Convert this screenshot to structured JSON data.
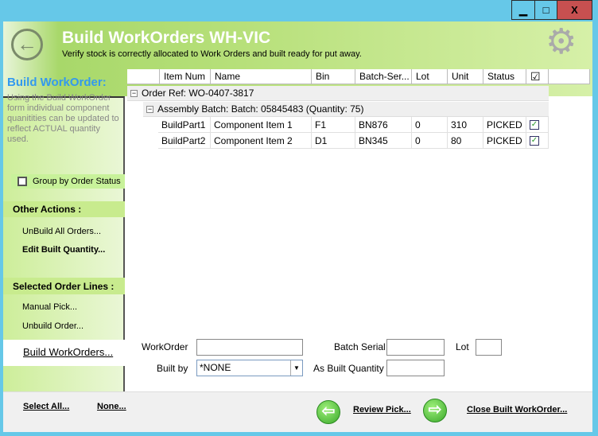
{
  "window": {
    "minimize": "▁",
    "maximize": "□",
    "close": "X"
  },
  "header": {
    "title": "Build WorkOrders WH-VIC",
    "subtitle": "Verify stock is correctly allocated to Work Orders and built ready for put away."
  },
  "sidebar": {
    "title": "Build WorkOrder:",
    "description": "Using the Build WorkOrder form individual component quanitities can be updated to reflect ACTUAL quantity used.",
    "group_by": "Group by Order Status",
    "group_by_checked": false,
    "other_actions": "Other Actions :",
    "unbuild_all": "UnBuild All Orders...",
    "edit_built": "Edit Built Quantity...",
    "selected_lines": "Selected Order Lines :",
    "manual_pick": "Manual Pick...",
    "unbuild_order": "Unbuild Order...",
    "build_workorders": "Build WorkOrders..."
  },
  "grid": {
    "columns": [
      "Item Num",
      "Name",
      "Bin",
      "Batch-Ser...",
      "Lot",
      "Unit",
      "Status",
      "☑"
    ],
    "order_ref": "Order Ref: WO-0407-3817",
    "assembly": "Assembly Batch: Batch: 05845483 (Quantity: 75)",
    "rows": [
      [
        "BuildPart1",
        "Component Item 1",
        "F1",
        "BN876",
        "0",
        "310",
        "PICKED",
        "✓"
      ],
      [
        "BuildPart2",
        "Component Item 2",
        "D1",
        "BN345",
        "0",
        "80",
        "PICKED",
        "✓"
      ]
    ]
  },
  "form": {
    "workorder_label": "WorkOrder",
    "workorder_value": "",
    "built_by_label": "Built by",
    "built_by_value": "*NONE",
    "batch_serial_label": "Batch Serial",
    "batch_serial_value": "",
    "lot_label": "Lot",
    "lot_value": "",
    "as_built_label": "As Built Quantity",
    "as_built_value": ""
  },
  "footer": {
    "select_all": "Select All...",
    "none": "None...",
    "review_pick": "Review Pick...",
    "close_built": "Close Built WorkOrder..."
  }
}
